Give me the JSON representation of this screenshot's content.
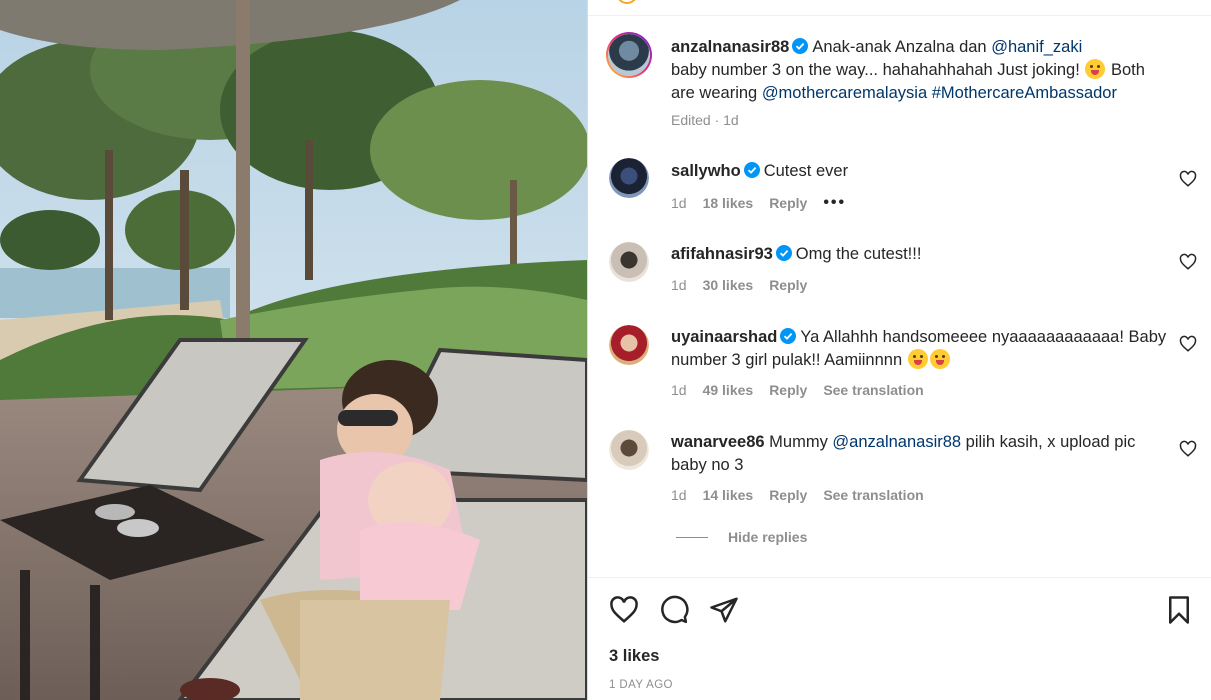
{
  "post": {
    "author": "anzalnanasir88",
    "caption_prefix": "Anak-anak Anzalna dan ",
    "caption_mention": "@hanif_zaki",
    "caption_line2": "baby number 3 on the way... hahahahhahah Just joking! ",
    "caption_after_emoji": " Both are wearing ",
    "caption_mention2": "@mothercaremalaysia",
    "caption_hashtag": "#MothercareAmbassador",
    "edited": "Edited · 1d"
  },
  "comments": [
    {
      "user": "sallywho",
      "text": "Cutest ever",
      "time": "1d",
      "likes": "18 likes",
      "reply": "Reply",
      "more": "•••"
    },
    {
      "user": "afifahnasir93",
      "text": "Omg the cutest!!!",
      "time": "1d",
      "likes": "30 likes",
      "reply": "Reply"
    },
    {
      "user": "uyainaarshad",
      "text": "Ya Allahhh handsomeeee nyaaaaaaaaaaaa! Baby number 3 girl pulak!! Aamiinnnn ",
      "time": "1d",
      "likes": "49 likes",
      "reply": "Reply",
      "translate": "See translation"
    },
    {
      "user": "wanarvee86",
      "text_prefix": "Mummy ",
      "mention": "@anzalnanasir88",
      "text_suffix": " pilih kasih, x upload pic baby no 3",
      "time": "1d",
      "likes": "14 likes",
      "reply": "Reply",
      "translate": "See translation"
    }
  ],
  "hide_replies": "Hide replies",
  "footer": {
    "likes": "3 likes",
    "posted": "1 DAY AGO"
  },
  "icons": {
    "verified": "verified-badge-icon",
    "like": "heart-icon",
    "comment": "comment-icon",
    "share": "share-icon",
    "save": "bookmark-icon"
  },
  "colors": {
    "verified": "#0095f6",
    "mention": "#00376b",
    "muted": "#8e8e8e"
  }
}
